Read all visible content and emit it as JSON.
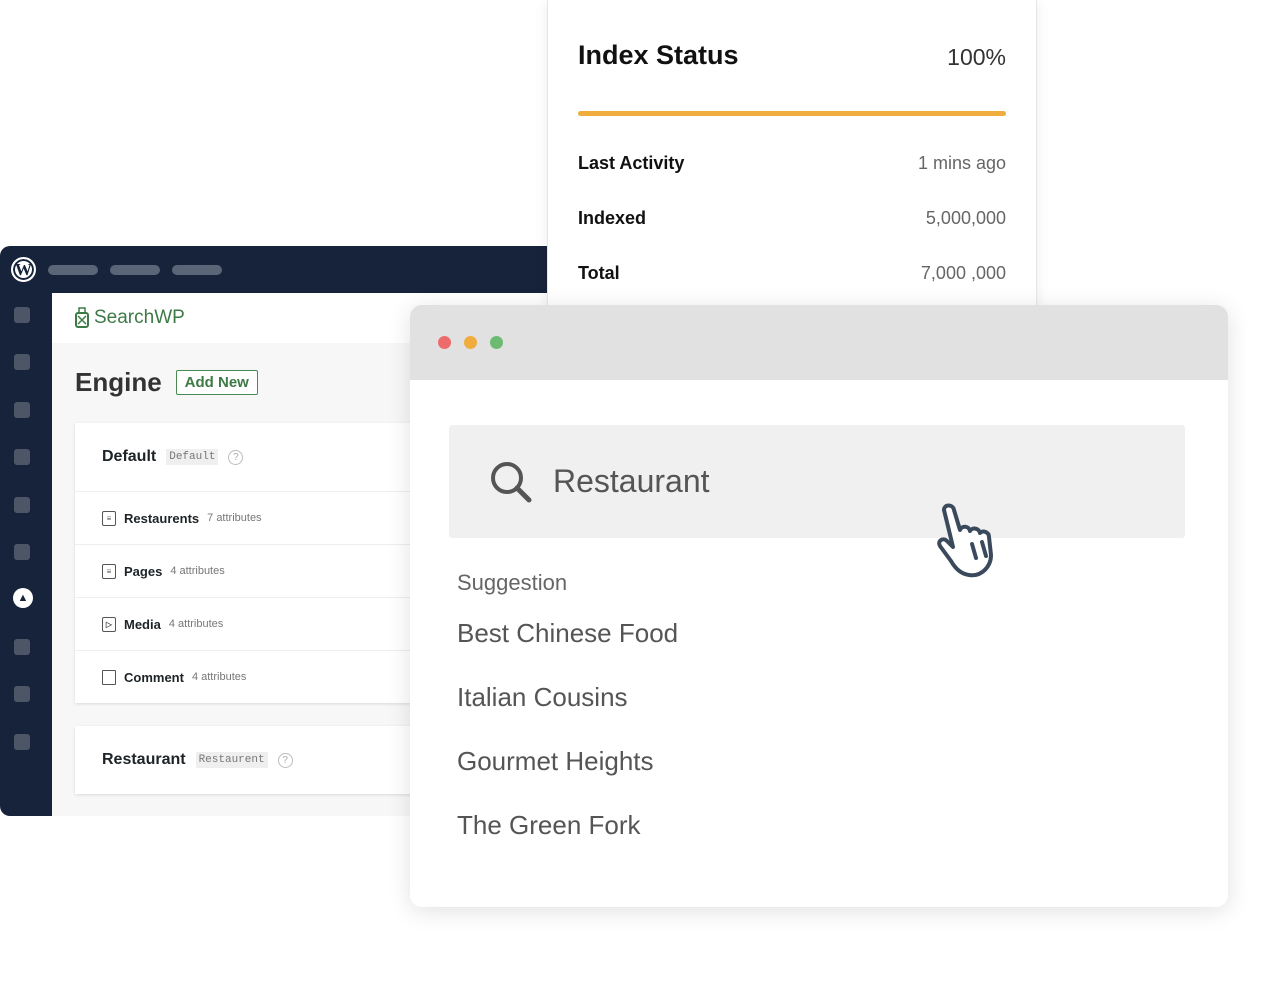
{
  "wp": {
    "logo": "W",
    "brand": "SearchWP",
    "engine_title": "Engine",
    "add_new": "Add New",
    "engines": [
      {
        "name": "Default",
        "tag": "Default",
        "sources": [
          {
            "icon": "document-plus-icon",
            "name": "Restaurents",
            "attrs": "7 attributes"
          },
          {
            "icon": "page-icon",
            "name": "Pages",
            "attrs": "4 attributes"
          },
          {
            "icon": "media-icon",
            "name": "Media",
            "attrs": "4 attributes"
          },
          {
            "icon": "comment-icon",
            "name": "Comment",
            "attrs": "4 attributes"
          }
        ]
      },
      {
        "name": "Restaurant",
        "tag": "Restaurent"
      }
    ]
  },
  "index": {
    "title": "Index Status",
    "percent": "100%",
    "progress": 100,
    "bar_color": "#f0ad3e",
    "stats": [
      {
        "label": "Last Activity",
        "value": "1 mins ago"
      },
      {
        "label": "Indexed",
        "value": "5,000,000"
      },
      {
        "label": "Total",
        "value": "7,000 ,000"
      }
    ]
  },
  "search": {
    "query": "Restaurant",
    "suggestion_label": "Suggestion",
    "suggestions": [
      "Best Chinese Food",
      "Italian Cousins",
      "Gourmet Heights",
      "The Green Fork"
    ],
    "dots": [
      "#ee6b6b",
      "#f0ad3e",
      "#6dbb72"
    ]
  }
}
